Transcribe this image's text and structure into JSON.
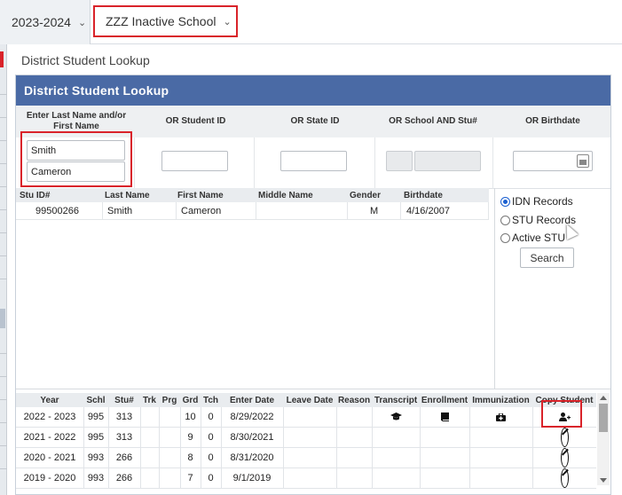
{
  "topbar": {
    "year": "2023-2024",
    "school": "ZZZ Inactive School"
  },
  "breadcrumb": "District Student Lookup",
  "panel": {
    "title": "District Student Lookup",
    "criteria": {
      "name_label": "Enter Last Name and/or First Name",
      "student_id_label": "OR Student ID",
      "state_id_label": "OR State ID",
      "school_stu_label": "OR School AND Stu#",
      "birthdate_label": "OR Birthdate",
      "last_name": "Smith",
      "first_name": "Cameron",
      "student_id": "",
      "state_id": "",
      "birthdate": ""
    },
    "results": {
      "columns": [
        "Stu ID#",
        "Last Name",
        "First Name",
        "Middle Name",
        "Gender",
        "Birthdate"
      ],
      "rows": [
        {
          "stu_id": "99500266",
          "last_name": "Smith",
          "first_name": "Cameron",
          "middle_name": "",
          "gender": "M",
          "birthdate": "4/16/2007"
        }
      ]
    },
    "record_options": {
      "options": [
        "IDN Records",
        "STU Records",
        "Active STU"
      ],
      "selected": "IDN Records",
      "search_label": "Search"
    },
    "enrollment": {
      "columns": [
        "Year",
        "Schl",
        "Stu#",
        "Trk",
        "Prg",
        "Grd",
        "Tch",
        "Enter Date",
        "Leave Date",
        "Reason",
        "Transcript",
        "Enrollment",
        "Immunization",
        "Copy Student"
      ],
      "rows": [
        {
          "year": "2022 - 2023",
          "schl": "995",
          "stu": "313",
          "trk": "",
          "prg": "",
          "grd": "10",
          "tch": "0",
          "enter": "8/29/2022",
          "leave": "",
          "reason": "",
          "copy": "add-user"
        },
        {
          "year": "2021 - 2022",
          "schl": "995",
          "stu": "313",
          "trk": "",
          "prg": "",
          "grd": "9",
          "tch": "0",
          "enter": "8/30/2021",
          "leave": "",
          "reason": "",
          "copy": "not-allowed"
        },
        {
          "year": "2020 - 2021",
          "schl": "993",
          "stu": "266",
          "trk": "",
          "prg": "",
          "grd": "8",
          "tch": "0",
          "enter": "8/31/2020",
          "leave": "",
          "reason": "",
          "copy": "not-allowed"
        },
        {
          "year": "2019 - 2020",
          "schl": "993",
          "stu": "266",
          "trk": "",
          "prg": "",
          "grd": "7",
          "tch": "0",
          "enter": "9/1/2019",
          "leave": "",
          "reason": "",
          "copy": "not-allowed"
        }
      ]
    }
  },
  "colors": {
    "header": "#4a6aa5",
    "highlight": "#d9232a",
    "radio": "#1a5fd0"
  }
}
